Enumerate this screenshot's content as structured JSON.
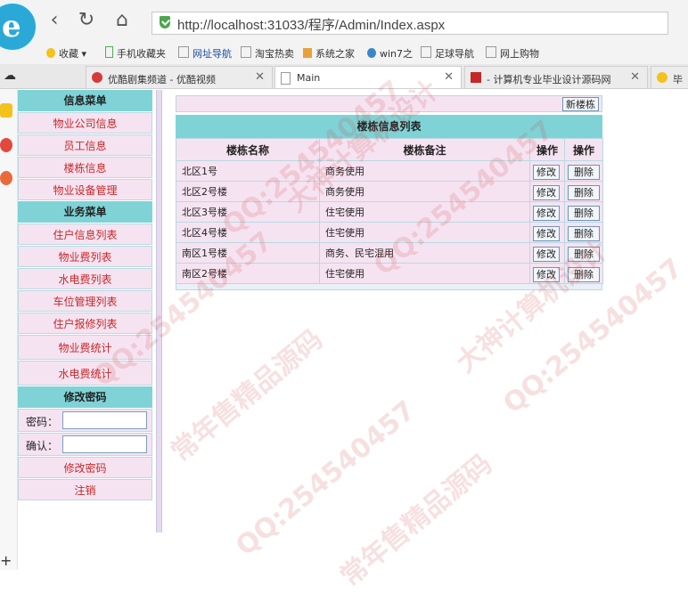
{
  "browser": {
    "address_url": "http://localhost:31033/程序/Admin/Index.aspx",
    "bookmarks": [
      "收藏",
      "手机收藏夹",
      "网址导航",
      "淘宝热卖",
      "系统之家",
      "win7之",
      "足球导航",
      "网上购物"
    ],
    "tabs": [
      {
        "label": "优酷剧集频道 - 优酷视频",
        "active": false
      },
      {
        "label": "Main",
        "active": true
      },
      {
        "label": "- 计算机专业毕业设计源码网",
        "active": false
      },
      {
        "label": "毕",
        "active": false
      }
    ]
  },
  "menu": {
    "sections": [
      {
        "title": "信息菜单",
        "items": [
          "物业公司信息",
          "员工信息",
          "楼栋信息",
          "物业设备管理"
        ]
      },
      {
        "title": "业务菜单",
        "items": [
          "住户信息列表",
          "物业费列表",
          "水电费列表",
          "车位管理列表",
          "住户报修列表",
          "物业费统计",
          "水电费统计"
        ]
      }
    ],
    "password_section": {
      "title": "修改密码",
      "password_label": "密码：",
      "confirm_label": "确认：",
      "password_value": "",
      "confirm_value": "",
      "submit_label": "修改密码",
      "logout_label": "注销"
    }
  },
  "main": {
    "new_button": "新楼栋",
    "table_title": "楼栋信息列表",
    "columns": [
      "楼栋名称",
      "楼栋备注",
      "操作",
      "操作"
    ],
    "rows": [
      {
        "name": "北区1号",
        "note": "商务使用"
      },
      {
        "name": "北区2号楼",
        "note": "商务使用"
      },
      {
        "name": "北区3号楼",
        "note": "住宅使用"
      },
      {
        "name": "北区4号楼",
        "note": "住宅使用"
      },
      {
        "name": "南区1号楼",
        "note": "商务、民宅混用"
      },
      {
        "name": "南区2号楼",
        "note": "住宅使用"
      }
    ],
    "edit_label": "修改",
    "delete_label": "删除"
  },
  "watermarks": [
    "QQ:254540457",
    "常年售精品源码",
    "大神计算机设计"
  ],
  "colors": {
    "header_bg": "#7fd3d6",
    "row_bg": "#f6e3f1",
    "menu_text": "#c62828",
    "border": "#b9d9e0"
  }
}
